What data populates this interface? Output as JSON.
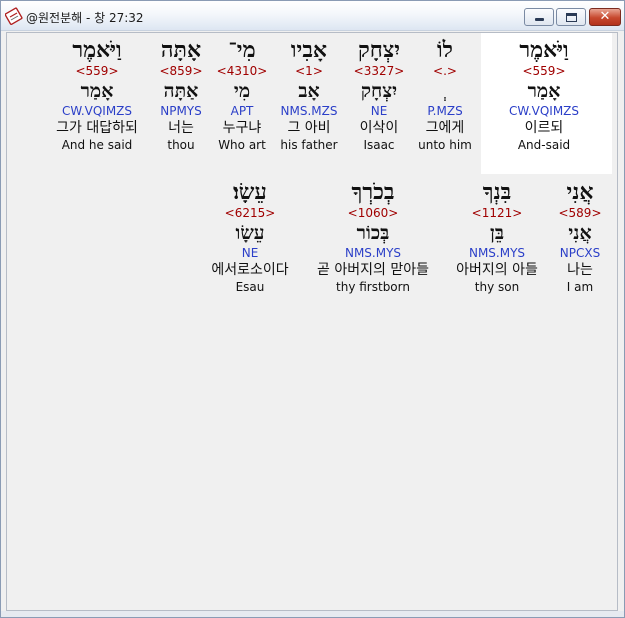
{
  "window": {
    "title": "@원전분해 - 창 27:32",
    "close_glyph": "✕",
    "icon": "app-book-icon"
  },
  "rows": [
    {
      "words": [
        {
          "hebrew": "וַיֹּאמֶר",
          "strong": "<559>",
          "lemma": "אָמַר",
          "parsing": "CW.VQIMZS",
          "korean": "이르되",
          "english": "And-said",
          "highlighted": true
        },
        {
          "hebrew": "לוֹ",
          "strong": "<.>",
          "lemma": "ְ",
          "parsing": "P.MZS",
          "korean": "그에게",
          "english": "unto him"
        },
        {
          "hebrew": "יִצְחָק",
          "strong": "<3327>",
          "lemma": "יִצְחָק",
          "parsing": "NE",
          "korean": "이삭이",
          "english": "Isaac"
        },
        {
          "hebrew": "אָבִיו",
          "strong": "<1>",
          "lemma": "אָב",
          "parsing": "NMS.MZS",
          "korean": "그 아비",
          "english": "his father"
        },
        {
          "hebrew": "מִי־",
          "strong": "<4310>",
          "lemma": "מִי",
          "parsing": "APT",
          "korean": "누구냐",
          "english": "Who art"
        },
        {
          "hebrew": "אָתָּה",
          "strong": "<859>",
          "lemma": "אַתָּה",
          "parsing": "NPMYS",
          "korean": "너는",
          "english": "thou"
        },
        {
          "hebrew": "וַיֹּאמֶר",
          "strong": "<559>",
          "lemma": "אָמַר",
          "parsing": "CW.VQIMZS",
          "korean": "그가 대답하되",
          "english": "And he said"
        }
      ]
    },
    {
      "words": [
        {
          "hebrew": "אֲנִי",
          "strong": "<589>",
          "lemma": "אֲנִי",
          "parsing": "NPCXS",
          "korean": "나는",
          "english": "I am"
        },
        {
          "hebrew": "בִּנְךָ",
          "strong": "<1121>",
          "lemma": "בֵּן",
          "parsing": "NMS.MYS",
          "korean": "아버지의 아들",
          "english": "thy son"
        },
        {
          "hebrew": "בְכֹרְךָ",
          "strong": "<1060>",
          "lemma": "בְּכוֹר",
          "parsing": "NMS.MYS",
          "korean": "곧 아버지의 맏아들",
          "english": "thy firstborn"
        },
        {
          "hebrew": "עֵשָׂו׃",
          "strong": "<6215>",
          "lemma": "עֵשָׂו",
          "parsing": "NE",
          "korean": "에서로소이다",
          "english": "Esau"
        }
      ]
    }
  ]
}
